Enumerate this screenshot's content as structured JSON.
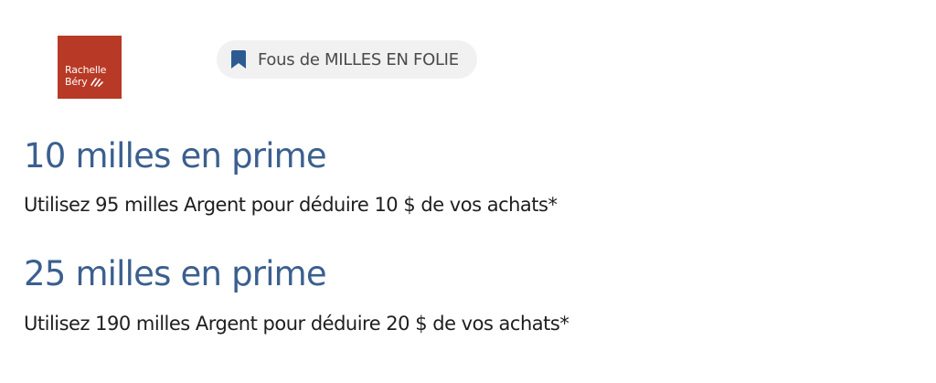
{
  "brand": {
    "logo_line1": "Rachelle",
    "logo_line2": "Béry",
    "logo_color": "#b83a26",
    "logo_icon": "leaf-icon"
  },
  "tag": {
    "icon": "bookmark-icon",
    "label": "Fous de MILLES EN FOLIE",
    "icon_color": "#2e5a92"
  },
  "offers": [
    {
      "title": "10 milles en prime",
      "description": "Utilisez 95 milles Argent pour déduire 10 $ de vos achats*"
    },
    {
      "title": "25 milles en prime",
      "description": "Utilisez 190 milles Argent pour déduire 20 $ de vos achats*"
    }
  ],
  "colors": {
    "title": "#3b5f8f",
    "text": "#1e1e1e",
    "tag_background": "#f1f1f1"
  }
}
